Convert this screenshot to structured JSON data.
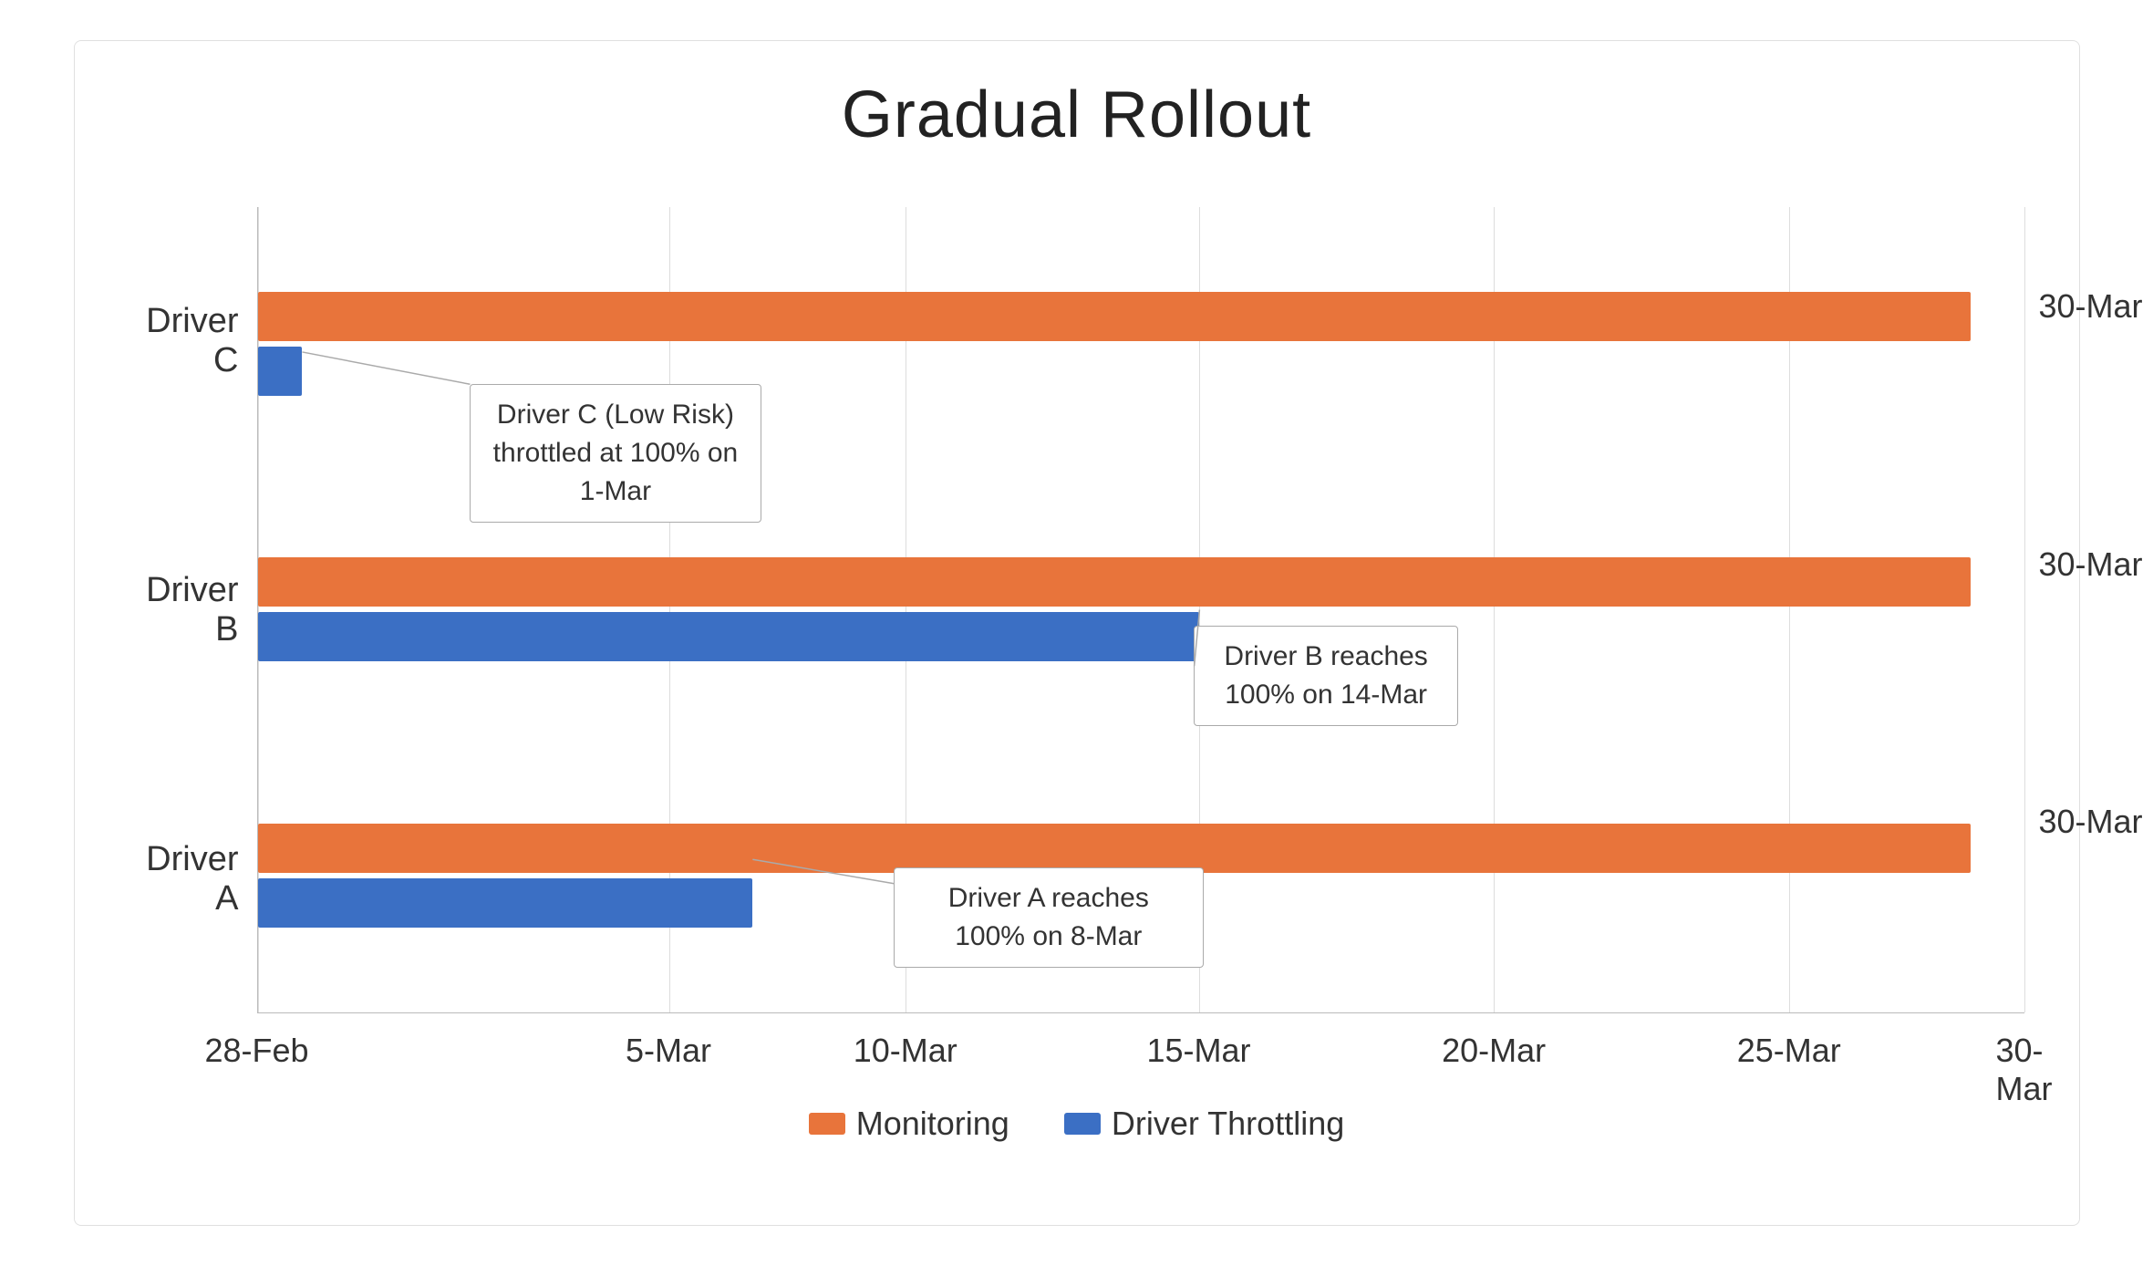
{
  "chart": {
    "title": "Gradual Rollout",
    "yLabels": [
      "Driver C",
      "Driver B",
      "Driver A"
    ],
    "xLabels": [
      "28-Feb",
      "5-Mar",
      "10-Mar",
      "15-Mar",
      "20-Mar",
      "25-Mar",
      "30-Mar"
    ],
    "rightLabels": [
      "30-Mar",
      "30-Mar",
      "30-Mar"
    ],
    "legend": {
      "monitoring": "Monitoring",
      "throttling": "Driver Throttling"
    },
    "colors": {
      "orange": "#E8743B",
      "blue": "#3B6FC4"
    },
    "annotations": [
      {
        "text": "Driver C (Low Risk) throttled at\n100% on 1-Mar",
        "id": "ann-c"
      },
      {
        "text": "Driver B reaches 100% on\n14-Mar",
        "id": "ann-b"
      },
      {
        "text": "Driver A reaches 100% on 8-Mar",
        "id": "ann-a"
      }
    ]
  }
}
